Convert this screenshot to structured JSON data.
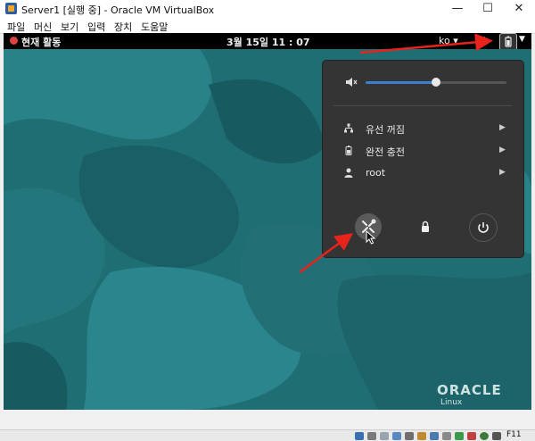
{
  "window": {
    "title": "Server1 [실행 중] - Oracle VM VirtualBox",
    "minimize": "—",
    "maximize": "☐",
    "close": "✕"
  },
  "menubar": {
    "items": [
      "파일",
      "머신",
      "보기",
      "입력",
      "장치",
      "도움말"
    ]
  },
  "topbar": {
    "activities": "현재 활동",
    "clock": "3월 15일  11 : 07",
    "language": "ko ▾",
    "caret": "▼"
  },
  "system_menu": {
    "volume_level": 0.5,
    "items": [
      {
        "icon": "network-icon",
        "label": "유선 꺼짐"
      },
      {
        "icon": "battery-icon",
        "label": "완전 충전"
      },
      {
        "icon": "user-icon",
        "label": "root"
      }
    ],
    "buttons": [
      "settings",
      "lock",
      "power"
    ]
  },
  "watermark": {
    "brand": "ORACLE",
    "product": "Linux"
  },
  "statusbar": {
    "host_key": "F11"
  },
  "colors": {
    "desktop": "#1f6e74",
    "menu_bg": "#343434",
    "accent_blue": "#3d7ed0",
    "arrow_red": "#e8231c"
  }
}
